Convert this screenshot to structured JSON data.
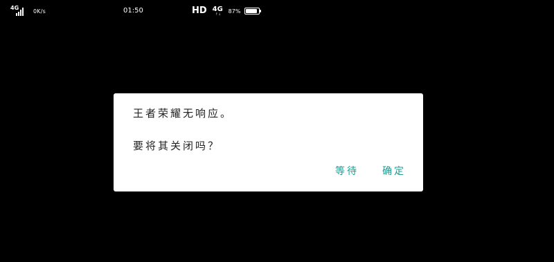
{
  "status_bar": {
    "left_network": "4G",
    "signal_bars_filled": 4,
    "speed": "0K/s",
    "time": "01:50",
    "hd": "HD",
    "right_network": "4G",
    "right_network_arrows": "↑↓",
    "battery_percent": "87%",
    "battery_level": 0.87
  },
  "dialog": {
    "line1": "王者荣耀无响应。",
    "line2": "要将其关闭吗？",
    "wait_label": "等待",
    "ok_label": "确定"
  },
  "colors": {
    "background": "#000000",
    "dialog_background": "#ffffff",
    "accent": "#1f9c92",
    "text": "#222222"
  }
}
